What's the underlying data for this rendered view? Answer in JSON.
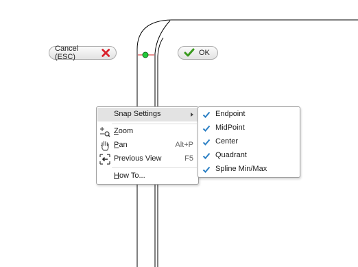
{
  "cancel_button": {
    "label": "Cancel (ESC)",
    "icon": "red-x-icon",
    "icon_color": "#d9232d"
  },
  "ok_button": {
    "label": "OK",
    "icon": "green-check-icon",
    "icon_color": "#3a9a1e"
  },
  "context_menu": {
    "items": [
      {
        "label": "Snap Settings",
        "has_submenu": true
      },
      {
        "label_first": "Z",
        "label_rest": "oom",
        "shortcut": "",
        "icon": "zoom-icon"
      },
      {
        "label_first": "P",
        "label_rest": "an",
        "shortcut": "Alt+P",
        "icon": "pan-hand-icon"
      },
      {
        "label": "Previous View",
        "shortcut": "F5",
        "icon": "previous-view-icon"
      },
      {
        "label_first": "H",
        "label_rest": "ow To...",
        "shortcut": ""
      }
    ]
  },
  "snap_submenu": {
    "check_color": "#2a7fc4",
    "items": [
      {
        "label": "Endpoint",
        "checked": true
      },
      {
        "label": "MidPoint",
        "checked": true
      },
      {
        "label": "Center",
        "checked": true
      },
      {
        "label": "Quadrant",
        "checked": true
      },
      {
        "label": "Spline Min/Max",
        "checked": true
      }
    ]
  },
  "sketch_point_color": "#22c93a",
  "sketch_constraint_color": "#d32020"
}
